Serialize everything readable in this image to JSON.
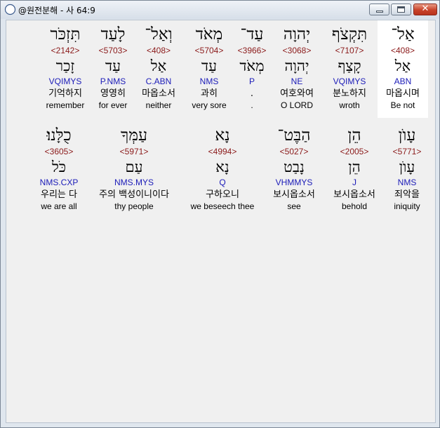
{
  "window": {
    "title": "@원전분해 - 사 64:9",
    "icon": "compass-app-icon",
    "buttons": {
      "minimize": "minimize-icon",
      "maximize": "maximize-icon",
      "close": "✕"
    }
  },
  "rows": [
    {
      "words": [
        {
          "hebrew": "אַל־",
          "strong": "<408>",
          "lemma": "אַל",
          "parse": "ABN",
          "korean": "마옵시며",
          "english": "Be not",
          "selected": true
        },
        {
          "hebrew": "תִּקְצֹף",
          "strong": "<7107>",
          "lemma": "קָצַף",
          "parse": "VQIMYS",
          "korean": "분노하지",
          "english": "wroth"
        },
        {
          "hebrew": "יְהוָה",
          "strong": "<3068>",
          "lemma": "יְהוָה",
          "parse": "NE",
          "korean": "여호와여",
          "english": "O LORD"
        },
        {
          "hebrew": "עַד־",
          "strong": "<3966>",
          "lemma": "מְאֹד",
          "parse": "P",
          "korean": ".",
          "english": "."
        },
        {
          "hebrew": "מְאֹד",
          "strong": "<5704>",
          "lemma": "עַד",
          "parse": "NMS",
          "korean": "과히",
          "english": "very sore"
        },
        {
          "hebrew": "וְאַל־",
          "strong": "<408>",
          "lemma": "אַל",
          "parse": "C.ABN",
          "korean": "마옵소서",
          "english": "neither"
        },
        {
          "hebrew": "לָעַד",
          "strong": "<5703>",
          "lemma": "עַד",
          "parse": "P.NMS",
          "korean": "영영히",
          "english": "for ever"
        },
        {
          "hebrew": "תִּזְכֹּר",
          "strong": "<2142>",
          "lemma": "זָכַר",
          "parse": "VQIMYS",
          "korean": "기억하지",
          "english": "remember"
        }
      ]
    },
    {
      "words": [
        {
          "hebrew": "עָוֺן",
          "strong": "<5771>",
          "lemma": "עָוֺן",
          "parse": "NMS",
          "korean": "죄악을",
          "english": "iniquity"
        },
        {
          "hebrew": "הֵן",
          "strong": "<2005>",
          "lemma": "הֵן",
          "parse": "J",
          "korean": "보시옵소서",
          "english": "behold"
        },
        {
          "hebrew": "הַבֶּט־",
          "strong": "<5027>",
          "lemma": "נָבַט",
          "parse": "VHMMYS",
          "korean": "보시옵소서",
          "english": "see"
        },
        {
          "hebrew": "נָא",
          "strong": "<4994>",
          "lemma": "נָא",
          "parse": "Q",
          "korean": "구하오니",
          "english": "we beseech thee"
        },
        {
          "hebrew": "עַמְּךָ",
          "strong": "<5971>",
          "lemma": "עַם",
          "parse": "NMS.MYS",
          "korean": "주의 백성이니이다",
          "english": "thy people"
        },
        {
          "hebrew": "כֻלָּנוּ׃",
          "strong": "<3605>",
          "lemma": "כֹּל",
          "parse": "NMS.CXP",
          "korean": "우리는 다",
          "english": "we are all"
        }
      ]
    }
  ]
}
